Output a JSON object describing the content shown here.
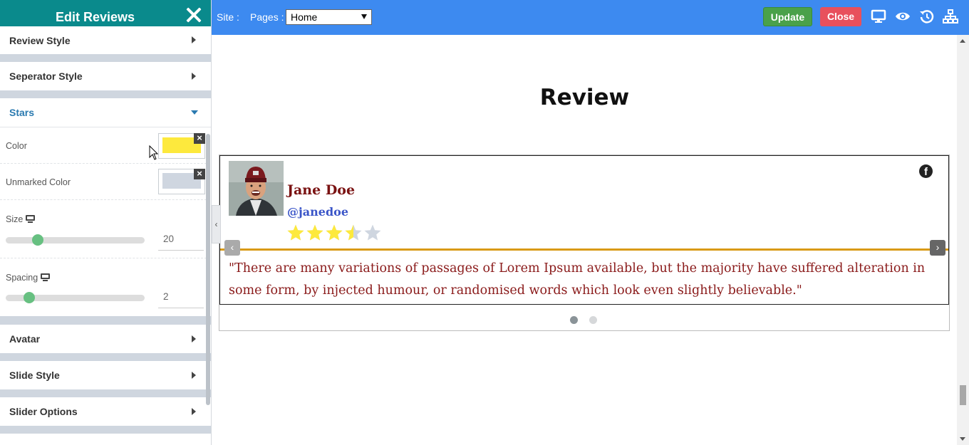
{
  "panel": {
    "title": "Edit Reviews",
    "sections": {
      "review_style": "Review Style",
      "separator_style": "Seperator Style",
      "stars": "Stars",
      "avatar": "Avatar",
      "slide_style": "Slide Style",
      "slider_options": "Slider Options"
    },
    "stars_settings": {
      "color_label": "Color",
      "color_value": "#fde93d",
      "unmarked_label": "Unmarked Color",
      "unmarked_value": "#cfd6e0",
      "size_label": "Size",
      "size_value": "20",
      "size_fraction": 0.19,
      "spacing_label": "Spacing",
      "spacing_value": "2",
      "spacing_fraction": 0.13
    }
  },
  "topbar": {
    "site_label": "Site :",
    "pages_label": "Pages :",
    "pages_selected": "Home",
    "update_label": "Update",
    "close_label": "Close",
    "icons": [
      "desktop-icon",
      "eye-icon",
      "history-icon",
      "sitemap-icon"
    ]
  },
  "canvas": {
    "heading": "Review",
    "review": {
      "name": "Jane Doe",
      "handle": "@janedoe",
      "rating": 3.5,
      "max_rating": 5,
      "quote": "\"There are many variations of passages of Lorem Ipsum available, but the majority have suffered alteration in some form, by injected humour, or randomised words which look even slightly believable.\"",
      "social_icon": "facebook-icon"
    },
    "nav": {
      "prev": "‹",
      "next": "›"
    },
    "pagination": {
      "total": 2,
      "active": 1
    },
    "collapse_glyph": "‹"
  },
  "colors": {
    "panel_header": "#0a8a8c",
    "topbar": "#3d8af0",
    "update": "#4aa14a",
    "close": "#e8505c",
    "separator": "#d99a16",
    "name": "#7a1212",
    "handle": "#3a55c8"
  }
}
